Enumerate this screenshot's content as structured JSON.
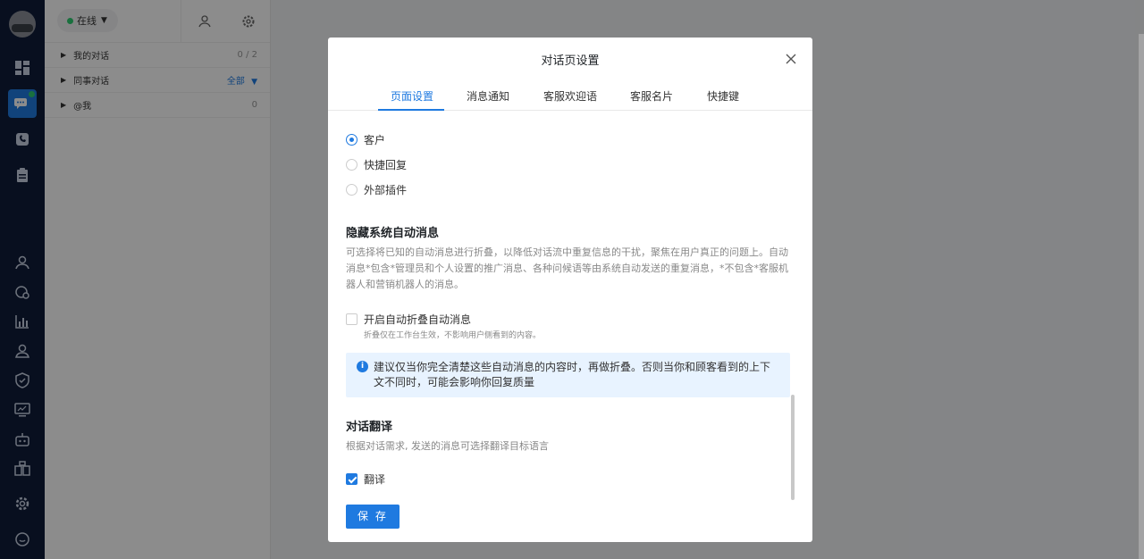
{
  "sidebar": {
    "status_label": "在线",
    "rows": [
      {
        "label": "我的对话",
        "count": "0 / 2"
      },
      {
        "label": "同事对话",
        "count": "全部"
      },
      {
        "label": "@我",
        "count": "0"
      }
    ]
  },
  "dialog": {
    "title": "对话页设置",
    "tabs": [
      "页面设置",
      "消息通知",
      "客服欢迎语",
      "客服名片",
      "快捷键"
    ],
    "active_tab": "页面设置",
    "radio_options": [
      {
        "label": "客户",
        "selected": true
      },
      {
        "label": "快捷回复",
        "selected": false
      },
      {
        "label": "外部插件",
        "selected": false
      }
    ],
    "hide_section": {
      "heading": "隐藏系统自动消息",
      "description": "可选择将已知的自动消息进行折叠，以降低对话流中重复信息的干扰，聚焦在用户真正的问题上。自动消息*包含*管理员和个人设置的推广消息、各种问候语等由系统自动发送的重复消息，*不包含*客服机器人和营销机器人的消息。",
      "checkbox_label": "开启自动折叠自动消息",
      "checkbox_hint": "折叠仅在工作台生效，不影响用户侧看到的内容。",
      "checked": false,
      "alert": "建议仅当你完全清楚这些自动消息的内容时，再做折叠。否则当你和顾客看到的上下文不同时，可能会影响你回复质量"
    },
    "translate_section": {
      "heading": "对话翻译",
      "description": "根据对话需求, 发送的消息可选择翻译目标语言",
      "checkbox_label": "翻译",
      "checked": true
    },
    "save_label": "保 存"
  },
  "colors": {
    "accent": "#1f7ae0",
    "rail": "#0f1d3a",
    "online": "#2ecc71"
  }
}
